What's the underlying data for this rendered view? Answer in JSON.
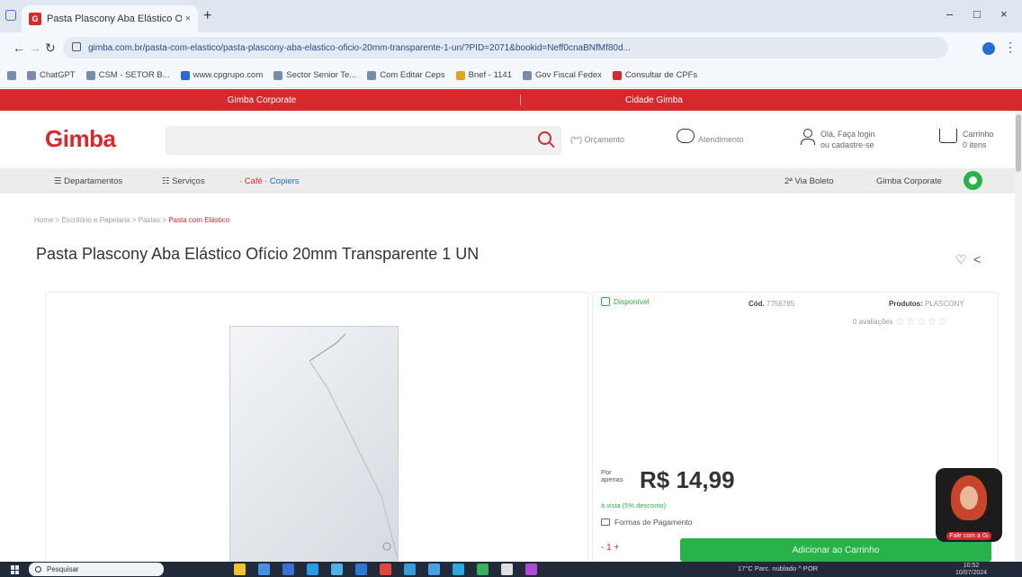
{
  "browser": {
    "tab_title": "Pasta Plascony Aba Elástico O...",
    "tab_favicon": "G",
    "tab_close": "×",
    "new_tab": "+",
    "window_controls": [
      "–",
      "□",
      "×"
    ],
    "nav_icons": [
      "←",
      "→",
      "↻"
    ],
    "url": "gimba.com.br/pasta-com-elastico/pasta-plascony-aba-elastico-oficio-20mm-transparente-1-un/?PID=2071&bookid=Neff0cnaBNfMf80d...",
    "kebab": "⋮",
    "bookmarks": [
      {
        "label": "ChatGPT",
        "color": "#7a8da8"
      },
      {
        "label": "CSM - SETOR B...",
        "color": "#7a8da8"
      },
      {
        "label": "www.cpgrupo.com",
        "color": "#2a6ad4"
      },
      {
        "label": "Sector Senior Te...",
        "color": "#7a8da8"
      },
      {
        "label": "Com Editar Ceps",
        "color": "#7a8da8"
      },
      {
        "label": "Bnef - 1141",
        "color": "#e0a420"
      },
      {
        "label": "Gov Fiscal Fedex",
        "color": "#7a8da8"
      },
      {
        "label": "Consultar de CPFs",
        "color": "#d52b2b"
      }
    ]
  },
  "site": {
    "brand_color": "#d7282c",
    "topbar": {
      "left": "Gimba Corporate",
      "right": "Cidade Gimba"
    },
    "logo": "Gimba",
    "search_placeholder": "",
    "header_links": {
      "orcamento": "(**) Orçamento",
      "atendimento": "Atendimento",
      "login_top": "Olá, Faça login",
      "login_bottom": "ou cadastre-se",
      "cart_top": "Carrinho",
      "cart_bottom": "0 itens"
    },
    "nav": {
      "departamentos": "☰ Departamentos",
      "servicos": "☷ Serviços",
      "cafe": "· Café",
      "copiers": "· Copiers",
      "boleto": "2ª Via Boleto",
      "corporate": "Gimba Corporate"
    },
    "breadcrumb": {
      "path": "Home > Escritório e Papelaria > Pastas > ",
      "current": "Pasta com Elástico"
    },
    "product": {
      "title": "Pasta Plascony Aba Elástico Ofício 20mm Transparente 1 UN",
      "heart": "♡",
      "share": "<",
      "availability": "Disponível",
      "cod_label": "Cód.",
      "cod_value": "7756785",
      "produtos_label": "Produtos:",
      "produtos_value": "PLASCONY",
      "rating_label": "0 avaliações",
      "stars": "☆☆☆☆☆",
      "por_text_1": "Por",
      "por_text_2": "apenas",
      "price": "R$ 14,99",
      "avista": "à vista (5% desconto)",
      "formas": "Formas de Pagamento",
      "qty": "-  1  +",
      "buy": "Adicionar ao Carrinho"
    },
    "assistant_label": "Fale com a Gi"
  },
  "taskbar": {
    "search_placeholder": "Pesquisar",
    "tray": "17°C Parc. nublado   ^   POR",
    "time": "10:52",
    "date": "10/07/2024",
    "apps": [
      "#f2c230",
      "#4a8fe0",
      "#3a6fd4",
      "#2a9be0",
      "#4fb0e8",
      "#2a7ad4",
      "#e04a3a",
      "#3a9ad8",
      "#4aa0e8",
      "#2fa8e0",
      "#3ab05a",
      "#e0e0e0",
      "#b04ad0"
    ]
  }
}
